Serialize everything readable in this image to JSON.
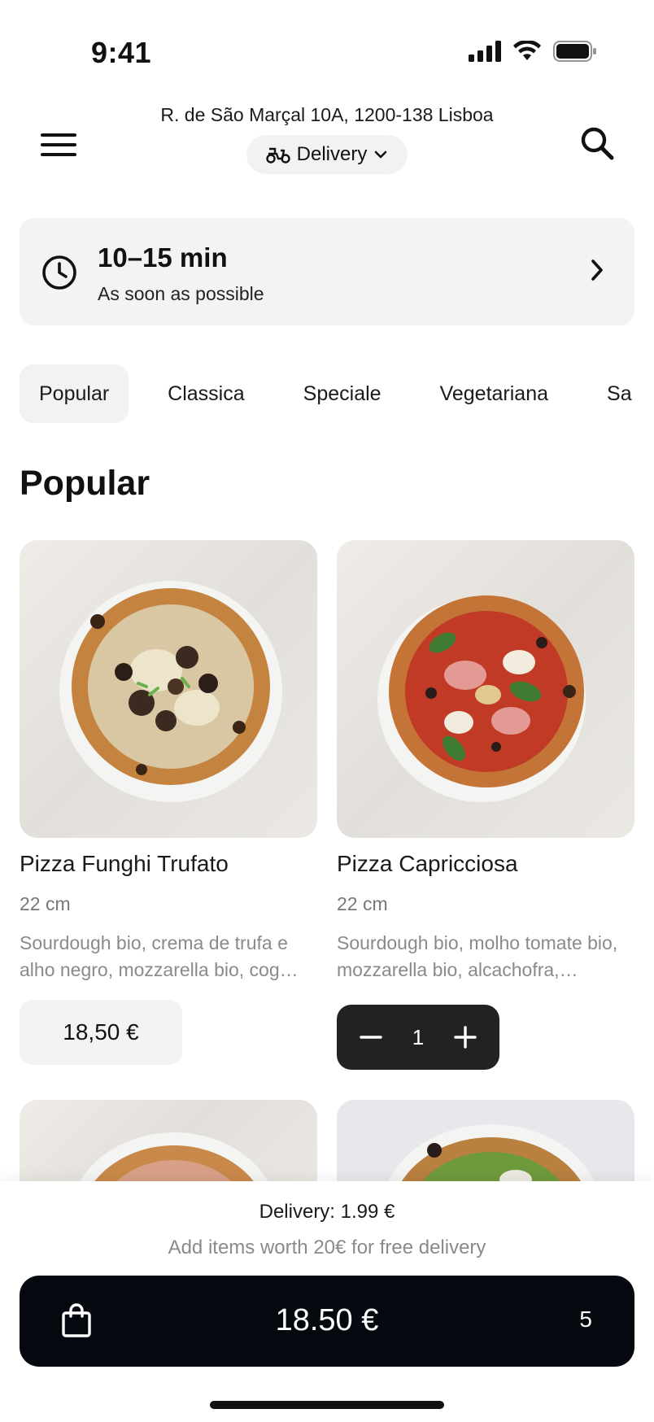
{
  "status_bar": {
    "time": "9:41"
  },
  "header": {
    "address": "R. de São Marçal 10A, 1200-138 Lisboa",
    "mode_label": "Delivery"
  },
  "eta": {
    "title": "10–15 min",
    "subtitle": "As soon as possible"
  },
  "tabs": [
    {
      "label": "Popular",
      "active": true
    },
    {
      "label": "Classica"
    },
    {
      "label": "Speciale"
    },
    {
      "label": "Vegetariana"
    },
    {
      "label": "Sa"
    }
  ],
  "section_title": "Popular",
  "products": [
    {
      "name": "Pizza Funghi Trufato",
      "size": "22 cm",
      "description": "Sourdough bio, crema de trufa e alho negro, mozzarella bio, cog…",
      "price": "18,50 €"
    },
    {
      "name": "Pizza Capricciosa",
      "size": "22 cm",
      "description": "Sourdough bio, molho tomate bio, mozzarella bio, alcachofra,…",
      "quantity": "1"
    }
  ],
  "bottom": {
    "delivery_fee": "Delivery: 1.99 €",
    "free_note": "Add items worth 20€ for free delivery",
    "cart_total": "18.50 €",
    "cart_count": "5"
  },
  "colors": {
    "cart_button": "#05090f",
    "stepper": "#222222",
    "surface": "#f3f3f3"
  }
}
